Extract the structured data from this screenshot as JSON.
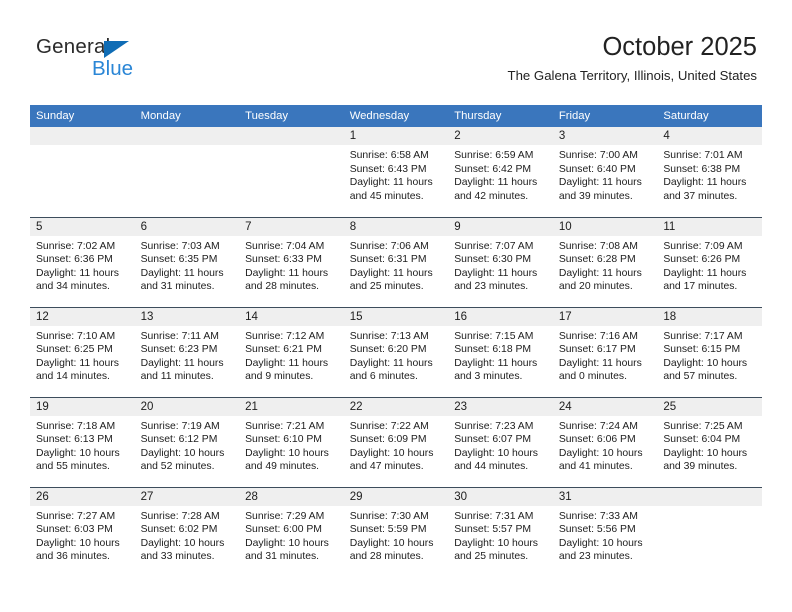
{
  "brand": {
    "name_part1": "General",
    "name_part2": "Blue",
    "triangle_color": "#0f6cb5",
    "blue_color": "#2a86d6"
  },
  "header": {
    "title": "October 2025",
    "subtitle": "The Galena Territory, Illinois, United States",
    "header_bg": "#3a76bd",
    "daynum_bg": "#efefef"
  },
  "calendar": {
    "weekday_headers": [
      "Sunday",
      "Monday",
      "Tuesday",
      "Wednesday",
      "Thursday",
      "Friday",
      "Saturday"
    ],
    "weeks": [
      [
        {
          "day": "",
          "sunrise": "",
          "sunset": "",
          "daylight_line1": "",
          "daylight_line2": ""
        },
        {
          "day": "",
          "sunrise": "",
          "sunset": "",
          "daylight_line1": "",
          "daylight_line2": ""
        },
        {
          "day": "",
          "sunrise": "",
          "sunset": "",
          "daylight_line1": "",
          "daylight_line2": ""
        },
        {
          "day": "1",
          "sunrise": "Sunrise: 6:58 AM",
          "sunset": "Sunset: 6:43 PM",
          "daylight_line1": "Daylight: 11 hours",
          "daylight_line2": "and 45 minutes."
        },
        {
          "day": "2",
          "sunrise": "Sunrise: 6:59 AM",
          "sunset": "Sunset: 6:42 PM",
          "daylight_line1": "Daylight: 11 hours",
          "daylight_line2": "and 42 minutes."
        },
        {
          "day": "3",
          "sunrise": "Sunrise: 7:00 AM",
          "sunset": "Sunset: 6:40 PM",
          "daylight_line1": "Daylight: 11 hours",
          "daylight_line2": "and 39 minutes."
        },
        {
          "day": "4",
          "sunrise": "Sunrise: 7:01 AM",
          "sunset": "Sunset: 6:38 PM",
          "daylight_line1": "Daylight: 11 hours",
          "daylight_line2": "and 37 minutes."
        }
      ],
      [
        {
          "day": "5",
          "sunrise": "Sunrise: 7:02 AM",
          "sunset": "Sunset: 6:36 PM",
          "daylight_line1": "Daylight: 11 hours",
          "daylight_line2": "and 34 minutes."
        },
        {
          "day": "6",
          "sunrise": "Sunrise: 7:03 AM",
          "sunset": "Sunset: 6:35 PM",
          "daylight_line1": "Daylight: 11 hours",
          "daylight_line2": "and 31 minutes."
        },
        {
          "day": "7",
          "sunrise": "Sunrise: 7:04 AM",
          "sunset": "Sunset: 6:33 PM",
          "daylight_line1": "Daylight: 11 hours",
          "daylight_line2": "and 28 minutes."
        },
        {
          "day": "8",
          "sunrise": "Sunrise: 7:06 AM",
          "sunset": "Sunset: 6:31 PM",
          "daylight_line1": "Daylight: 11 hours",
          "daylight_line2": "and 25 minutes."
        },
        {
          "day": "9",
          "sunrise": "Sunrise: 7:07 AM",
          "sunset": "Sunset: 6:30 PM",
          "daylight_line1": "Daylight: 11 hours",
          "daylight_line2": "and 23 minutes."
        },
        {
          "day": "10",
          "sunrise": "Sunrise: 7:08 AM",
          "sunset": "Sunset: 6:28 PM",
          "daylight_line1": "Daylight: 11 hours",
          "daylight_line2": "and 20 minutes."
        },
        {
          "day": "11",
          "sunrise": "Sunrise: 7:09 AM",
          "sunset": "Sunset: 6:26 PM",
          "daylight_line1": "Daylight: 11 hours",
          "daylight_line2": "and 17 minutes."
        }
      ],
      [
        {
          "day": "12",
          "sunrise": "Sunrise: 7:10 AM",
          "sunset": "Sunset: 6:25 PM",
          "daylight_line1": "Daylight: 11 hours",
          "daylight_line2": "and 14 minutes."
        },
        {
          "day": "13",
          "sunrise": "Sunrise: 7:11 AM",
          "sunset": "Sunset: 6:23 PM",
          "daylight_line1": "Daylight: 11 hours",
          "daylight_line2": "and 11 minutes."
        },
        {
          "day": "14",
          "sunrise": "Sunrise: 7:12 AM",
          "sunset": "Sunset: 6:21 PM",
          "daylight_line1": "Daylight: 11 hours",
          "daylight_line2": "and 9 minutes."
        },
        {
          "day": "15",
          "sunrise": "Sunrise: 7:13 AM",
          "sunset": "Sunset: 6:20 PM",
          "daylight_line1": "Daylight: 11 hours",
          "daylight_line2": "and 6 minutes."
        },
        {
          "day": "16",
          "sunrise": "Sunrise: 7:15 AM",
          "sunset": "Sunset: 6:18 PM",
          "daylight_line1": "Daylight: 11 hours",
          "daylight_line2": "and 3 minutes."
        },
        {
          "day": "17",
          "sunrise": "Sunrise: 7:16 AM",
          "sunset": "Sunset: 6:17 PM",
          "daylight_line1": "Daylight: 11 hours",
          "daylight_line2": "and 0 minutes."
        },
        {
          "day": "18",
          "sunrise": "Sunrise: 7:17 AM",
          "sunset": "Sunset: 6:15 PM",
          "daylight_line1": "Daylight: 10 hours",
          "daylight_line2": "and 57 minutes."
        }
      ],
      [
        {
          "day": "19",
          "sunrise": "Sunrise: 7:18 AM",
          "sunset": "Sunset: 6:13 PM",
          "daylight_line1": "Daylight: 10 hours",
          "daylight_line2": "and 55 minutes."
        },
        {
          "day": "20",
          "sunrise": "Sunrise: 7:19 AM",
          "sunset": "Sunset: 6:12 PM",
          "daylight_line1": "Daylight: 10 hours",
          "daylight_line2": "and 52 minutes."
        },
        {
          "day": "21",
          "sunrise": "Sunrise: 7:21 AM",
          "sunset": "Sunset: 6:10 PM",
          "daylight_line1": "Daylight: 10 hours",
          "daylight_line2": "and 49 minutes."
        },
        {
          "day": "22",
          "sunrise": "Sunrise: 7:22 AM",
          "sunset": "Sunset: 6:09 PM",
          "daylight_line1": "Daylight: 10 hours",
          "daylight_line2": "and 47 minutes."
        },
        {
          "day": "23",
          "sunrise": "Sunrise: 7:23 AM",
          "sunset": "Sunset: 6:07 PM",
          "daylight_line1": "Daylight: 10 hours",
          "daylight_line2": "and 44 minutes."
        },
        {
          "day": "24",
          "sunrise": "Sunrise: 7:24 AM",
          "sunset": "Sunset: 6:06 PM",
          "daylight_line1": "Daylight: 10 hours",
          "daylight_line2": "and 41 minutes."
        },
        {
          "day": "25",
          "sunrise": "Sunrise: 7:25 AM",
          "sunset": "Sunset: 6:04 PM",
          "daylight_line1": "Daylight: 10 hours",
          "daylight_line2": "and 39 minutes."
        }
      ],
      [
        {
          "day": "26",
          "sunrise": "Sunrise: 7:27 AM",
          "sunset": "Sunset: 6:03 PM",
          "daylight_line1": "Daylight: 10 hours",
          "daylight_line2": "and 36 minutes."
        },
        {
          "day": "27",
          "sunrise": "Sunrise: 7:28 AM",
          "sunset": "Sunset: 6:02 PM",
          "daylight_line1": "Daylight: 10 hours",
          "daylight_line2": "and 33 minutes."
        },
        {
          "day": "28",
          "sunrise": "Sunrise: 7:29 AM",
          "sunset": "Sunset: 6:00 PM",
          "daylight_line1": "Daylight: 10 hours",
          "daylight_line2": "and 31 minutes."
        },
        {
          "day": "29",
          "sunrise": "Sunrise: 7:30 AM",
          "sunset": "Sunset: 5:59 PM",
          "daylight_line1": "Daylight: 10 hours",
          "daylight_line2": "and 28 minutes."
        },
        {
          "day": "30",
          "sunrise": "Sunrise: 7:31 AM",
          "sunset": "Sunset: 5:57 PM",
          "daylight_line1": "Daylight: 10 hours",
          "daylight_line2": "and 25 minutes."
        },
        {
          "day": "31",
          "sunrise": "Sunrise: 7:33 AM",
          "sunset": "Sunset: 5:56 PM",
          "daylight_line1": "Daylight: 10 hours",
          "daylight_line2": "and 23 minutes."
        },
        {
          "day": "",
          "sunrise": "",
          "sunset": "",
          "daylight_line1": "",
          "daylight_line2": ""
        }
      ]
    ]
  }
}
